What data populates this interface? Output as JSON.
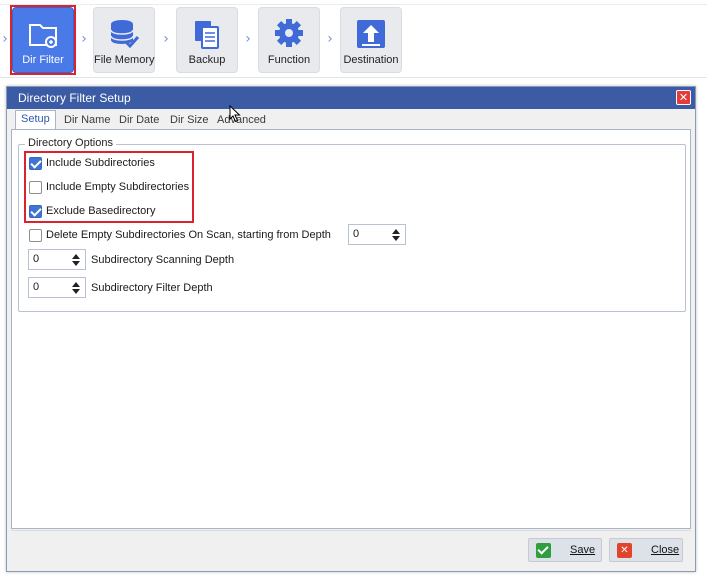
{
  "toolbar": {
    "steps": [
      {
        "label": "Dir Filter",
        "icon": "folder-icon",
        "active": true
      },
      {
        "label": "File Memory",
        "icon": "database-icon",
        "active": false
      },
      {
        "label": "Backup",
        "icon": "copy-icon",
        "active": false
      },
      {
        "label": "Function",
        "icon": "gear-icon",
        "active": false
      },
      {
        "label": "Destination",
        "icon": "upload-icon",
        "active": false
      }
    ],
    "separator": "›"
  },
  "dialog": {
    "title": "Directory Filter Setup",
    "close_glyph": "✕",
    "tabs": [
      {
        "label": "Setup",
        "active": true
      },
      {
        "label": "Dir Name"
      },
      {
        "label": "Dir Date"
      },
      {
        "label": "Dir Size"
      },
      {
        "label": "Advanced"
      }
    ],
    "group_title": "Directory Options",
    "options": [
      {
        "label": "Include Subdirectories",
        "checked": true
      },
      {
        "label": "Include Empty Subdirectories",
        "checked": false
      },
      {
        "label": "Exclude Basedirectory",
        "checked": true
      },
      {
        "label": "Delete Empty Subdirectories On Scan, starting from Depth",
        "checked": false
      }
    ],
    "delete_depth_value": "0",
    "scanning_depth": {
      "value": "0",
      "label": "Subdirectory Scanning Depth"
    },
    "filter_depth": {
      "value": "0",
      "label": "Subdirectory Filter Depth"
    },
    "buttons": {
      "save": "Save",
      "close": "Close",
      "close_glyph": "✕"
    }
  },
  "colors": {
    "accent": "#4a79e8",
    "titlebar": "#3b5ba5",
    "highlight": "#d9232e"
  }
}
